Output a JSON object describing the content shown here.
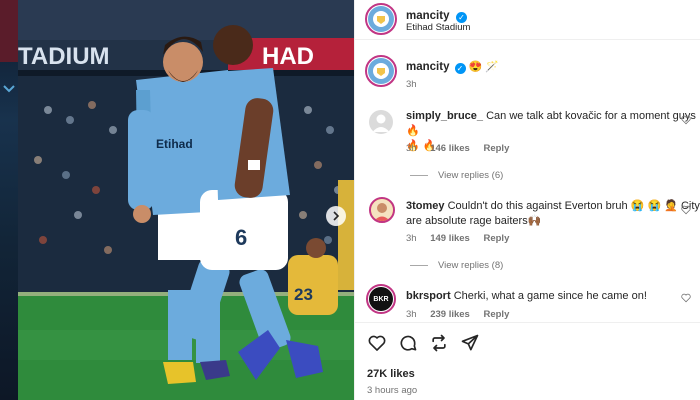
{
  "post": {
    "username": "mancity",
    "location": "Etihad Stadium",
    "caption_emojis": "😍 🪄",
    "caption_time": "3h",
    "likes": "27K likes",
    "posted": "3 hours ago"
  },
  "photo": {
    "banner_text_left": "TADIUM",
    "banner_text_right": "HAD",
    "shirt_number": "6",
    "opponent_number": "23",
    "sponsor": "Etihad"
  },
  "comments": [
    {
      "username": "simply_bruce_",
      "text": "Can we talk abt kovačic for a moment guys 🔥",
      "text_line2": "🔥 🔥",
      "time": "3h",
      "likes": "146 likes",
      "reply": "Reply",
      "view_replies": "View replies (6)"
    },
    {
      "username": "3tomey",
      "text": "Couldn't do this against Everton bruh 😭 😭 🤦 City",
      "text_line2": "are absolute rage baiters🙌🏾",
      "time": "3h",
      "likes": "149 likes",
      "reply": "Reply",
      "view_replies": "View replies (8)"
    },
    {
      "username": "bkrsport",
      "text": "Cherki, what a game since he came on!",
      "time": "3h",
      "likes": "239 likes",
      "reply": "Reply",
      "avatar_text": "BKR"
    }
  ],
  "icons": [
    "heart-icon",
    "comment-icon",
    "repost-icon",
    "share-icon",
    "verified-icon",
    "chevron-right-icon"
  ],
  "colors": {
    "city_blue": "#6cabdd",
    "link_blue": "#0095f6",
    "story_ring": "#c13584"
  }
}
